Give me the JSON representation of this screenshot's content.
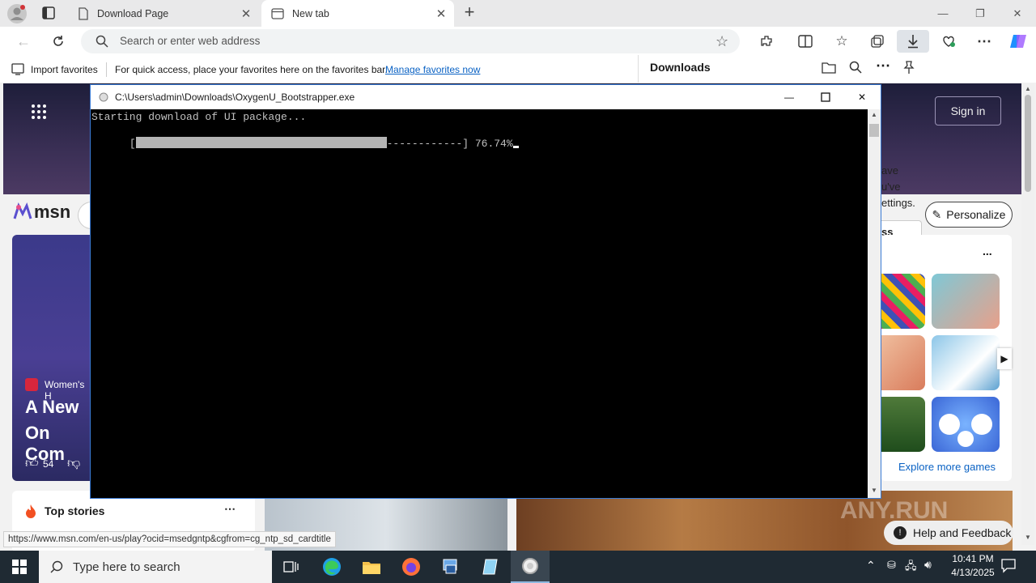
{
  "browser": {
    "tabs": [
      {
        "title": "Download Page",
        "active": false
      },
      {
        "title": "New tab",
        "active": true
      }
    ],
    "new_tab_symbol": "+",
    "omnibox_placeholder": "Search or enter web address",
    "favorites_bar": {
      "import_label": "Import favorites",
      "hint": "For quick access, place your favorites here on the favorites bar.",
      "manage_link": "Manage favorites now"
    },
    "downloads_panel": {
      "title": "Downloads",
      "partial_lines": [
        "ave",
        "u've",
        "ettings."
      ],
      "partial_button": "ss"
    }
  },
  "msn_page": {
    "logo_text": "msn",
    "sign_in": "Sign in",
    "personalize": "Personalize",
    "card": {
      "source": "Women's H",
      "headline_line1": "A New",
      "headline_line2": "On Com",
      "likes": "54"
    },
    "top_stories": "Top stories",
    "games_more": "...",
    "explore_games": "Explore more games",
    "help_feedback": "Help and Feedback",
    "status_url": "https://www.msn.com/en-us/play?ocid=msedgntp&cgfrom=cg_ntp_sd_cardtitle",
    "watermark": "ANY.RUN"
  },
  "console": {
    "title": "C:\\Users\\admin\\Downloads\\OxygenU_Bootstrapper.exe",
    "line1": "Starting download of UI package...",
    "progress_open": "[",
    "progress_rest": "------------] 76.74%",
    "progress_fraction": 0.7674
  },
  "taskbar": {
    "search_placeholder": "Type here to search",
    "time": "10:41 PM",
    "date": "4/13/2025"
  },
  "colors": {
    "accent": "#0a62c4",
    "console_bg": "#000000",
    "console_text": "#c0c0c0",
    "progress_fill": "#b4b4b4",
    "taskbar": "#1f2a33"
  }
}
